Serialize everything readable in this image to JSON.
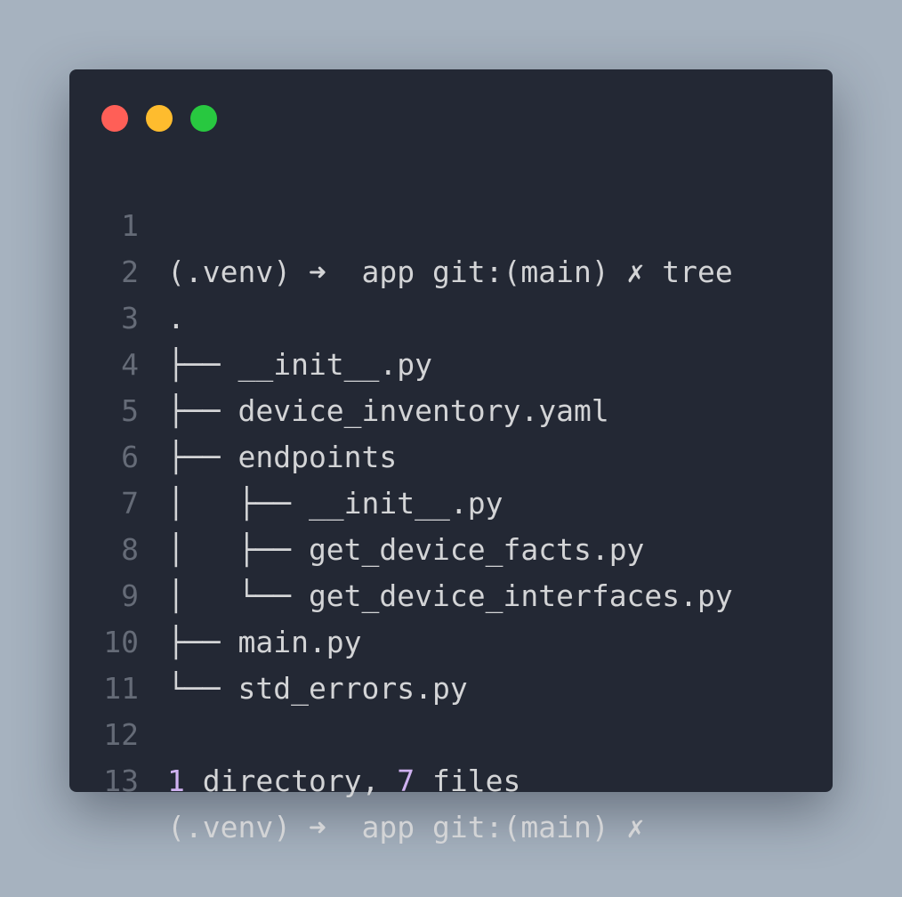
{
  "window": {
    "dots": [
      {
        "name": "close",
        "color": "#ff5f57"
      },
      {
        "name": "minimize",
        "color": "#febc2e"
      },
      {
        "name": "zoom",
        "color": "#28c840"
      }
    ]
  },
  "terminal": {
    "colors": {
      "text": "#d3d4d6",
      "line_number": "#656b77",
      "number_highlight": "#cfb1f0",
      "background": "#232834"
    },
    "lines": [
      {
        "num": "1",
        "text": "(.venv) ➜  app git:(main) ✗ tree"
      },
      {
        "num": "2",
        "text": "."
      },
      {
        "num": "3",
        "text": "├── __init__.py"
      },
      {
        "num": "4",
        "text": "├── device_inventory.yaml"
      },
      {
        "num": "5",
        "text": "├── endpoints"
      },
      {
        "num": "6",
        "text": "│   ├── __init__.py"
      },
      {
        "num": "7",
        "text": "│   ├── get_device_facts.py"
      },
      {
        "num": "8",
        "text": "│   └── get_device_interfaces.py"
      },
      {
        "num": "9",
        "text": "├── main.py"
      },
      {
        "num": "10",
        "text": "└── std_errors.py"
      },
      {
        "num": "11",
        "text": ""
      },
      {
        "num": "12",
        "summary": {
          "dir_count": "1",
          "dir_label": " directory, ",
          "file_count": "7",
          "file_label": " files"
        }
      },
      {
        "num": "13",
        "text": "(.venv) ➜  app git:(main) ✗"
      }
    ]
  }
}
